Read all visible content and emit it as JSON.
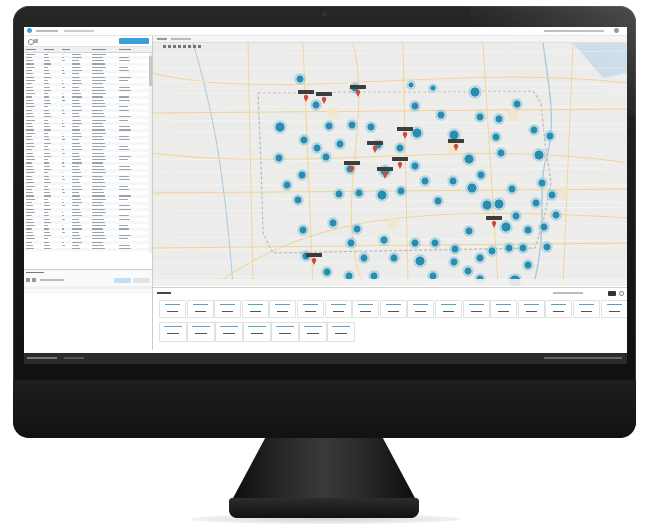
{
  "device": {
    "type": "desktop-monitor",
    "bezel_color": "#1b1b1b",
    "stand_color": "#222222"
  },
  "app": {
    "topbar": {
      "logo_icon": "app-logo-icon",
      "user_menu_icon": "user-menu-icon"
    },
    "left_panel": {
      "add_button_color": "#3aa0d8",
      "row_count": 60,
      "status_color_active": "#4caf50",
      "lower_section_buttons": 2
    },
    "map": {
      "background": "#ececea",
      "road_color": "#f2d28c",
      "border_color": "#b8b8b8",
      "cluster_color": "#2a8db0",
      "marker_color": "#d04a32"
    },
    "stats_panel": {
      "accent_color": "#2a8db0",
      "row1_cards": 17,
      "row2_cards": 7
    },
    "status_bar": {
      "background": "#2b2b2b"
    }
  }
}
